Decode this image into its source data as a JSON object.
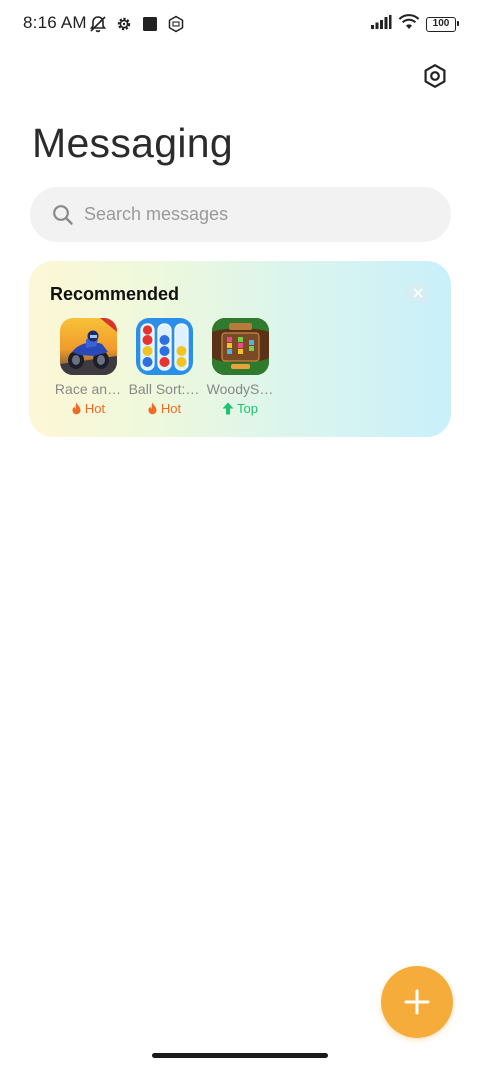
{
  "status_bar": {
    "time": "8:16 AM",
    "battery": "100",
    "icons_left": [
      "notifications-off-icon",
      "gear-cog-icon",
      "square-icon",
      "sim-icon"
    ],
    "icons_right": [
      "signal-icon",
      "wifi-icon",
      "battery-icon"
    ]
  },
  "header": {
    "title": "Messaging",
    "settings_icon": "hexagon-settings-icon"
  },
  "search": {
    "placeholder": "Search messages",
    "value": ""
  },
  "recommended": {
    "title": "Recommended",
    "apps": [
      {
        "name": "Race an…",
        "badge": "Hot",
        "badge_type": "hot",
        "icon": "motorcycle-race-icon"
      },
      {
        "name": "Ball Sort:…",
        "badge": "Hot",
        "badge_type": "hot",
        "icon": "ball-sort-icon"
      },
      {
        "name": "WoodyS…",
        "badge": "Top",
        "badge_type": "top",
        "icon": "woody-sort-icon"
      }
    ]
  },
  "colors": {
    "accent": "#f6ac3b",
    "hot": "#f06a23",
    "top": "#1ec36e"
  }
}
